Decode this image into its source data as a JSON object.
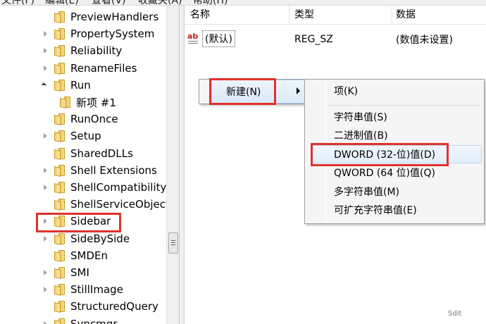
{
  "menubar": {
    "items": [
      "文件(F)",
      "编辑(E)",
      "查看(V)",
      "收藏夹(A)",
      "帮助(H)"
    ]
  },
  "tree": {
    "items": [
      {
        "label": "PreviewHandlers",
        "state": "none"
      },
      {
        "label": "PropertySystem",
        "state": "collapsed"
      },
      {
        "label": "Reliability",
        "state": "collapsed"
      },
      {
        "label": "RenameFiles",
        "state": "collapsed"
      },
      {
        "label": "Run",
        "state": "expanded"
      },
      {
        "label": "新项 #1",
        "state": "child"
      },
      {
        "label": "RunOnce",
        "state": "none"
      },
      {
        "label": "Setup",
        "state": "collapsed"
      },
      {
        "label": "SharedDLLs",
        "state": "none"
      },
      {
        "label": "Shell Extensions",
        "state": "collapsed"
      },
      {
        "label": "ShellCompatibility",
        "state": "collapsed"
      },
      {
        "label": "ShellServiceObjectD",
        "state": "none"
      },
      {
        "label": "Sidebar",
        "state": "collapsed"
      },
      {
        "label": "SideBySide",
        "state": "collapsed"
      },
      {
        "label": "SMDEn",
        "state": "none"
      },
      {
        "label": "SMI",
        "state": "collapsed"
      },
      {
        "label": "StillImage",
        "state": "collapsed"
      },
      {
        "label": "StructuredQuery",
        "state": "none"
      },
      {
        "label": "Syncmgr",
        "state": "collapsed"
      }
    ]
  },
  "list": {
    "columns": [
      "名称",
      "类型",
      "数据"
    ],
    "rows": [
      {
        "name": "(默认)",
        "type": "REG_SZ",
        "data": "(数值未设置)"
      }
    ]
  },
  "context_menu": {
    "new_label": "新建(N)"
  },
  "submenu": {
    "items": [
      {
        "label": "项(K)"
      },
      {
        "label": "字符串值(S)"
      },
      {
        "label": "二进制值(B)"
      },
      {
        "label": "DWORD (32-位)值(D)"
      },
      {
        "label": "QWORD (64 位)值(Q)"
      },
      {
        "label": "多字符串值(M)"
      },
      {
        "label": "可扩充字符串值(E)"
      }
    ]
  },
  "colors": {
    "highlight_box": "#e0312d",
    "menu_hover": "#dbe9f8"
  },
  "icons": {
    "tree_folder": "folder-icon",
    "value_type": "reg-string-icon",
    "submenu": "chevron-right-icon"
  }
}
